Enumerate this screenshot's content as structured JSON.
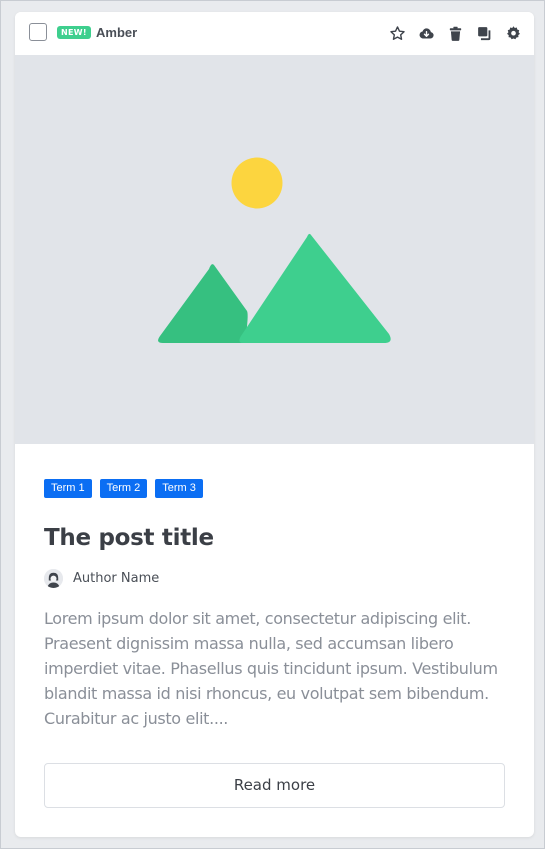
{
  "toolbar": {
    "badge": "NEW!",
    "theme_name": "Amber",
    "icons": [
      "star-icon",
      "cloud-download-icon",
      "trash-icon",
      "copy-icon",
      "gear-icon"
    ]
  },
  "post": {
    "terms": [
      "Term 1",
      "Term 2",
      "Term 3"
    ],
    "title": "The post title",
    "author": "Author Name",
    "excerpt": "Lorem ipsum dolor sit amet, consectetur adipiscing elit. Praesent dignissim massa nulla, sed accumsan libero imperdiet vitae. Phasellus quis tincidunt ipsum. Vestibulum blandit massa id nisi rhoncus, eu volutpat sem bibendum. Curabitur ac justo elit....",
    "read_more": "Read more"
  },
  "colors": {
    "badge": "#3ecf8e",
    "term": "#0b6ef3",
    "placeholder_bg": "#e1e4e9",
    "sun": "#fcd53f",
    "mountain_back": "#36c080",
    "mountain_front": "#3ecf8e"
  }
}
